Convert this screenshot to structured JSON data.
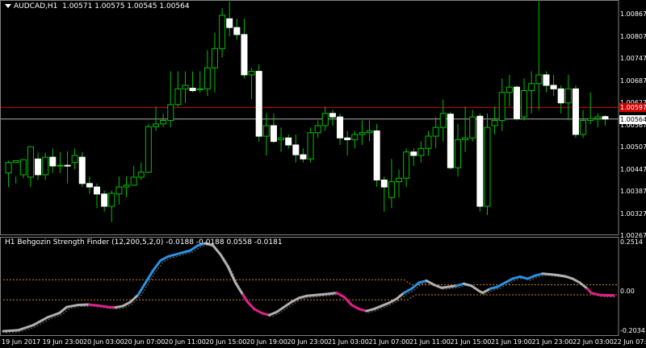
{
  "symbol_header": {
    "symbol_tf": "AUDCAD,H1",
    "ohlc": "1.00571 1.00575 1.00545 1.00564"
  },
  "indicator": {
    "name": "H1 Behgozin Strength Finder (12,200,5,2,0)",
    "values": "-0.0188 -0.0188 0.0558 -0.0181",
    "axis_labels": [
      "0.2514",
      "0.00",
      "-0.2034"
    ]
  },
  "price_axis": {
    "labels": [
      "1.00867",
      "1.00807",
      "1.00747",
      "1.00687",
      "1.00627",
      "1.00567",
      "1.00507",
      "1.00447",
      "1.00387",
      "1.00327",
      "1.00267"
    ],
    "bid_tag": "1.00564",
    "red_tag": "1.00597"
  },
  "time_axis": {
    "labels": [
      "19 Jun 2017",
      "19 Jun 23:00",
      "20 Jun 03:00",
      "20 Jun 07:00",
      "20 Jun 11:00",
      "20 Jun 15:00",
      "20 Jun 19:00",
      "20 Jun 23:00",
      "21 Jun 03:00",
      "21 Jun 07:00",
      "21 Jun 11:00",
      "21 Jun 15:00",
      "21 Jun 19:00",
      "21 Jun 23:00",
      "22 Jun 03:00",
      "22 Jun 07:00"
    ]
  },
  "colors": {
    "background": "#000000",
    "bull_candle": "#00c000",
    "bear_candle": "#ffffff",
    "red_line": "#d00000",
    "grey_line": "#b0b0b0",
    "blue_segment": "#2f8fe0",
    "pink_segment": "#e0208a",
    "level_line": "#d08020"
  },
  "chart_data": {
    "type": "candlestick",
    "x": [
      "19 Jun 2017",
      "19 Jun 23:00",
      "20 Jun 03:00",
      "20 Jun 07:00",
      "20 Jun 11:00",
      "20 Jun 15:00",
      "20 Jun 19:00",
      "20 Jun 23:00",
      "21 Jun 03:00",
      "21 Jun 07:00",
      "21 Jun 11:00",
      "21 Jun 15:00",
      "21 Jun 19:00",
      "21 Jun 23:00",
      "22 Jun 03:00",
      "22 Jun 07:00"
    ],
    "candles": [
      [
        1.0041,
        1.0044,
        1.0037,
        1.00445
      ],
      [
        1.0044,
        1.00445,
        1.0038,
        1.004
      ],
      [
        1.00405,
        1.00448,
        1.00395,
        1.0043
      ],
      [
        1.00398,
        1.00485,
        1.0037,
        1.0045
      ],
      [
        1.0045,
        1.00405,
        1.0039,
        1.00468
      ],
      [
        1.00405,
        1.00455,
        1.0039,
        1.00468
      ],
      [
        1.00455,
        1.0043,
        1.0041,
        1.0048
      ],
      [
        1.0043,
        1.00432,
        1.0041,
        1.0047
      ],
      [
        1.00432,
        1.0043,
        1.0038,
        1.00472
      ],
      [
        1.0044,
        1.0046,
        1.0042,
        1.0048
      ],
      [
        1.00455,
        1.0038,
        1.0037,
        1.0047
      ],
      [
        1.0038,
        1.0037,
        1.0035,
        1.004
      ],
      [
        1.0037,
        1.0035,
        1.0031,
        1.0038
      ],
      [
        1.0035,
        1.00315,
        1.003,
        1.0036
      ],
      [
        1.00315,
        1.00352,
        1.0027,
        1.0036
      ],
      [
        1.0035,
        1.0037,
        1.0032,
        1.004
      ],
      [
        1.0037,
        1.00375,
        1.0034,
        1.004
      ],
      [
        1.00375,
        1.00398,
        1.0038,
        1.0043
      ],
      [
        1.00398,
        1.00412,
        1.0039,
        1.0044
      ],
      [
        1.00412,
        1.00542,
        1.0041,
        1.0055
      ],
      [
        1.00542,
        1.0055,
        1.0053,
        1.006
      ],
      [
        1.0055,
        1.0056,
        1.0054,
        1.0058
      ],
      [
        1.0056,
        1.00605,
        1.0054,
        1.007
      ],
      [
        1.00605,
        1.0065,
        1.006,
        1.007
      ],
      [
        1.0065,
        1.0066,
        1.0061,
        1.007
      ],
      [
        1.00652,
        1.00645,
        1.0064,
        1.007
      ],
      [
        1.00648,
        1.0065,
        1.0064,
        1.007
      ],
      [
        1.0065,
        1.0071,
        1.0063,
        1.0076
      ],
      [
        1.0071,
        1.00765,
        1.0064,
        1.0081
      ],
      [
        1.00765,
        1.0086,
        1.0074,
        1.0088
      ],
      [
        1.0085,
        1.00825,
        1.008,
        1.009
      ],
      [
        1.00825,
        1.00805,
        1.0079,
        1.0085
      ],
      [
        1.00805,
        1.0069,
        1.0068,
        1.0085
      ],
      [
        1.0069,
        1.007,
        1.0062,
        1.0071
      ],
      [
        1.007,
        1.00515,
        1.005,
        1.0072
      ],
      [
        1.00515,
        1.00545,
        1.0046,
        1.0058
      ],
      [
        1.00545,
        1.005,
        1.00495,
        1.0058
      ],
      [
        1.00505,
        1.0051,
        1.0047,
        1.0054
      ],
      [
        1.0051,
        1.0049,
        1.0048,
        1.0052
      ],
      [
        1.0049,
        1.00462,
        1.0044,
        1.0052
      ],
      [
        1.00462,
        1.0045,
        1.0044,
        1.0048
      ],
      [
        1.0045,
        1.00525,
        1.0044,
        1.0054
      ],
      [
        1.00525,
        1.00545,
        1.0051,
        1.0056
      ],
      [
        1.00545,
        1.0058,
        1.0053,
        1.006
      ],
      [
        1.0058,
        1.0057,
        1.00545,
        1.0059
      ],
      [
        1.0057,
        1.0051,
        1.0049,
        1.0058
      ],
      [
        1.0051,
        1.00505,
        1.0046,
        1.0053
      ],
      [
        1.00505,
        1.0052,
        1.0048,
        1.0053
      ],
      [
        1.0052,
        1.00525,
        1.0049,
        1.0056
      ],
      [
        1.00525,
        1.0053,
        1.005,
        1.0056
      ],
      [
        1.0053,
        1.0039,
        1.0037,
        1.0055
      ],
      [
        1.0039,
        1.0037,
        1.003,
        1.004
      ],
      [
        1.0034,
        1.00385,
        1.0031,
        1.0045
      ],
      [
        1.00385,
        1.00395,
        1.0034,
        1.0042
      ],
      [
        1.00395,
        1.0047,
        1.0037,
        1.0048
      ],
      [
        1.0047,
        1.0046,
        1.0043,
        1.0048
      ],
      [
        1.0046,
        1.0048,
        1.0044,
        1.005
      ],
      [
        1.0048,
        1.00515,
        1.0046,
        1.0053
      ],
      [
        1.00515,
        1.0054,
        1.0048,
        1.0057
      ],
      [
        1.0054,
        1.0058,
        1.005,
        1.0062
      ],
      [
        1.00578,
        1.00425,
        1.0042,
        1.00585
      ],
      [
        1.00425,
        1.00505,
        1.004,
        1.0055
      ],
      [
        1.00505,
        1.0051,
        1.0047,
        1.006
      ],
      [
        1.0051,
        1.0057,
        1.005,
        1.0059
      ],
      [
        1.00572,
        1.00315,
        1.003,
        1.0058
      ],
      [
        1.00315,
        1.0054,
        1.0029,
        1.0058
      ],
      [
        1.00545,
        1.0056,
        1.0052,
        1.006
      ],
      [
        1.0056,
        1.0064,
        1.0053,
        1.0068
      ],
      [
        1.0064,
        1.00655,
        1.006,
        1.0069
      ],
      [
        1.00655,
        1.00565,
        1.0056,
        1.0066
      ],
      [
        1.0057,
        1.00645,
        1.0056,
        1.0068
      ],
      [
        1.00645,
        1.00665,
        1.0058,
        1.007
      ],
      [
        1.00665,
        1.0069,
        1.0059,
        1.009
      ],
      [
        1.0069,
        1.0066,
        1.0064,
        1.007
      ],
      [
        1.0066,
        1.0065,
        1.0063,
        1.0069
      ],
      [
        1.0065,
        1.0061,
        1.0058,
        1.0066
      ],
      [
        1.0061,
        1.0065,
        1.0056,
        1.0069
      ],
      [
        1.0065,
        1.0052,
        1.0051,
        1.0066
      ],
      [
        1.0052,
        1.0056,
        1.0051,
        1.0059
      ],
      [
        1.0056,
        1.00565,
        1.0055,
        1.0064
      ],
      [
        1.00565,
        1.0057,
        1.0054,
        1.0058
      ],
      [
        1.00571,
        1.00564,
        1.00545,
        1.00575
      ]
    ],
    "candle_fields": [
      "open",
      "close",
      "low",
      "high"
    ],
    "price_range": [
      1.00237,
      1.00899
    ],
    "horizontal_lines": [
      1.00597,
      1.00564
    ],
    "indicator_range": [
      -0.2034,
      0.2514
    ],
    "indicator_levels": [
      0.055,
      -0.045
    ],
    "indicator_series": [
      [
        0,
        -0.2,
        "grey"
      ],
      [
        4,
        -0.195,
        "grey"
      ],
      [
        8,
        -0.17,
        "grey"
      ],
      [
        12,
        -0.13,
        "grey"
      ],
      [
        15,
        -0.11,
        "grey"
      ],
      [
        17,
        -0.08,
        "grey"
      ],
      [
        20,
        -0.07,
        "grey"
      ],
      [
        23,
        -0.068,
        "grey"
      ],
      [
        25,
        -0.072,
        "pink"
      ],
      [
        28,
        -0.08,
        "pink"
      ],
      [
        30,
        -0.082,
        "pink"
      ],
      [
        32,
        -0.075,
        "grey"
      ],
      [
        34,
        -0.055,
        "grey"
      ],
      [
        36,
        -0.02,
        "grey"
      ],
      [
        38,
        0.04,
        "blue"
      ],
      [
        40,
        0.1,
        "blue"
      ],
      [
        42,
        0.15,
        "blue"
      ],
      [
        44,
        0.17,
        "blue"
      ],
      [
        47,
        0.185,
        "blue"
      ],
      [
        50,
        0.2,
        "blue"
      ],
      [
        52,
        0.225,
        "blue"
      ],
      [
        54,
        0.235,
        "blue"
      ],
      [
        56,
        0.225,
        "grey"
      ],
      [
        58,
        0.18,
        "grey"
      ],
      [
        60,
        0.12,
        "grey"
      ],
      [
        62,
        0.04,
        "grey"
      ],
      [
        64,
        -0.02,
        "grey"
      ],
      [
        65,
        -0.05,
        "pink"
      ],
      [
        67,
        -0.09,
        "pink"
      ],
      [
        69,
        -0.11,
        "pink"
      ],
      [
        71,
        -0.12,
        "pink"
      ],
      [
        73,
        -0.105,
        "grey"
      ],
      [
        75,
        -0.08,
        "grey"
      ],
      [
        77,
        -0.055,
        "grey"
      ],
      [
        79,
        -0.035,
        "grey"
      ],
      [
        81,
        -0.025,
        "grey"
      ],
      [
        84,
        -0.02,
        "grey"
      ],
      [
        87,
        -0.015,
        "grey"
      ],
      [
        89,
        -0.01,
        "grey"
      ],
      [
        91,
        -0.03,
        "pink"
      ],
      [
        93,
        -0.07,
        "pink"
      ],
      [
        95,
        -0.09,
        "pink"
      ],
      [
        97,
        -0.1,
        "pink"
      ],
      [
        99,
        -0.09,
        "grey"
      ],
      [
        101,
        -0.075,
        "grey"
      ],
      [
        103,
        -0.06,
        "grey"
      ],
      [
        105,
        -0.04,
        "grey"
      ],
      [
        107,
        -0.01,
        "grey"
      ],
      [
        109,
        0.01,
        "blue"
      ],
      [
        111,
        0.04,
        "blue"
      ],
      [
        113,
        0.05,
        "blue"
      ],
      [
        115,
        0.03,
        "grey"
      ],
      [
        117,
        0.015,
        "grey"
      ],
      [
        119,
        0.02,
        "grey"
      ],
      [
        121,
        0.025,
        "grey"
      ],
      [
        123,
        0.035,
        "blue"
      ],
      [
        125,
        0.025,
        "grey"
      ],
      [
        127,
        0.0,
        "grey"
      ],
      [
        128,
        -0.01,
        "grey"
      ],
      [
        130,
        0.01,
        "grey"
      ],
      [
        132,
        0.02,
        "blue"
      ],
      [
        134,
        0.04,
        "blue"
      ],
      [
        136,
        0.06,
        "blue"
      ],
      [
        138,
        0.07,
        "blue"
      ],
      [
        140,
        0.06,
        "blue"
      ],
      [
        142,
        0.075,
        "blue"
      ],
      [
        144,
        0.085,
        "blue"
      ],
      [
        146,
        0.082,
        "grey"
      ],
      [
        148,
        0.078,
        "grey"
      ],
      [
        150,
        0.072,
        "grey"
      ],
      [
        152,
        0.06,
        "grey"
      ],
      [
        154,
        0.04,
        "grey"
      ],
      [
        156,
        0.01,
        "grey"
      ],
      [
        157,
        -0.01,
        "pink"
      ],
      [
        159,
        -0.02,
        "pink"
      ],
      [
        161,
        -0.022,
        "pink"
      ],
      [
        163,
        -0.022,
        "pink"
      ]
    ],
    "indicator_series_fields": [
      "index",
      "value",
      "color"
    ],
    "indicator_x_count": 164
  }
}
